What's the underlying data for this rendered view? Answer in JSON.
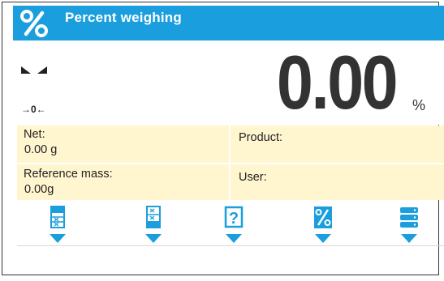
{
  "header": {
    "title": "Percent weighing",
    "icon": "percent-icon",
    "color": "#1b9ede"
  },
  "display": {
    "value": "0.00",
    "unit": "%",
    "zero_indicator": "→0←",
    "stability_icon": "stable-indicator-icon"
  },
  "info": {
    "net_label": "Net:",
    "net_value": "0.00 g",
    "product_label": "Product:",
    "product_value": "",
    "reference_mass_label": "Reference mass:",
    "reference_mass_value": "0.00g",
    "user_label": "User:",
    "user_value": ""
  },
  "buttons": [
    {
      "icon": "sample-quantity-icon"
    },
    {
      "icon": "reference-sample-icon"
    },
    {
      "icon": "help-question-icon"
    },
    {
      "icon": "percent-mode-icon"
    },
    {
      "icon": "database-icon"
    }
  ],
  "colors": {
    "accent": "#1b9ede",
    "info_bg": "#fff5cf",
    "text": "#333333"
  }
}
